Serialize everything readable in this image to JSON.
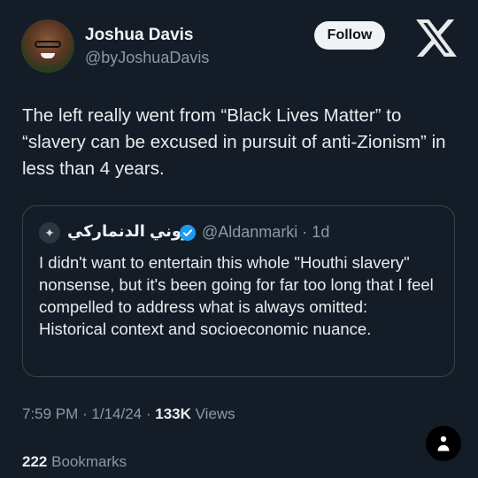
{
  "author": {
    "display_name": "Joshua Davis",
    "handle": "@byJoshuaDavis",
    "follow_label": "Follow",
    "avatar_icon": "profile-photo"
  },
  "brand": {
    "logo": "x-logo"
  },
  "tweet": {
    "text": "The left really went from “Black Lives Matter” to “slavery can be excused in pursuit of anti-Zionism” in less than 4 years."
  },
  "quoted_tweet": {
    "display_name": "روني الدنماركي",
    "verified": true,
    "handle_and_time": "@Aldanmarki · 1d",
    "text": "I didn't want to entertain this whole \"Houthi slavery\" nonsense, but it's been going for far too long that I feel compelled to address what is always omitted: Historical context and socioeconomic nuance."
  },
  "meta": {
    "time": "7:59 PM",
    "date": "1/14/24",
    "views_count": "133K",
    "views_label": "Views"
  },
  "bookmarks": {
    "count": "222",
    "label": "Bookmarks"
  },
  "colors": {
    "background": "#141d27",
    "secondary_text": "#8b98a5",
    "verified_blue": "#1d9bf0",
    "follow_button": "#eff3f4"
  }
}
